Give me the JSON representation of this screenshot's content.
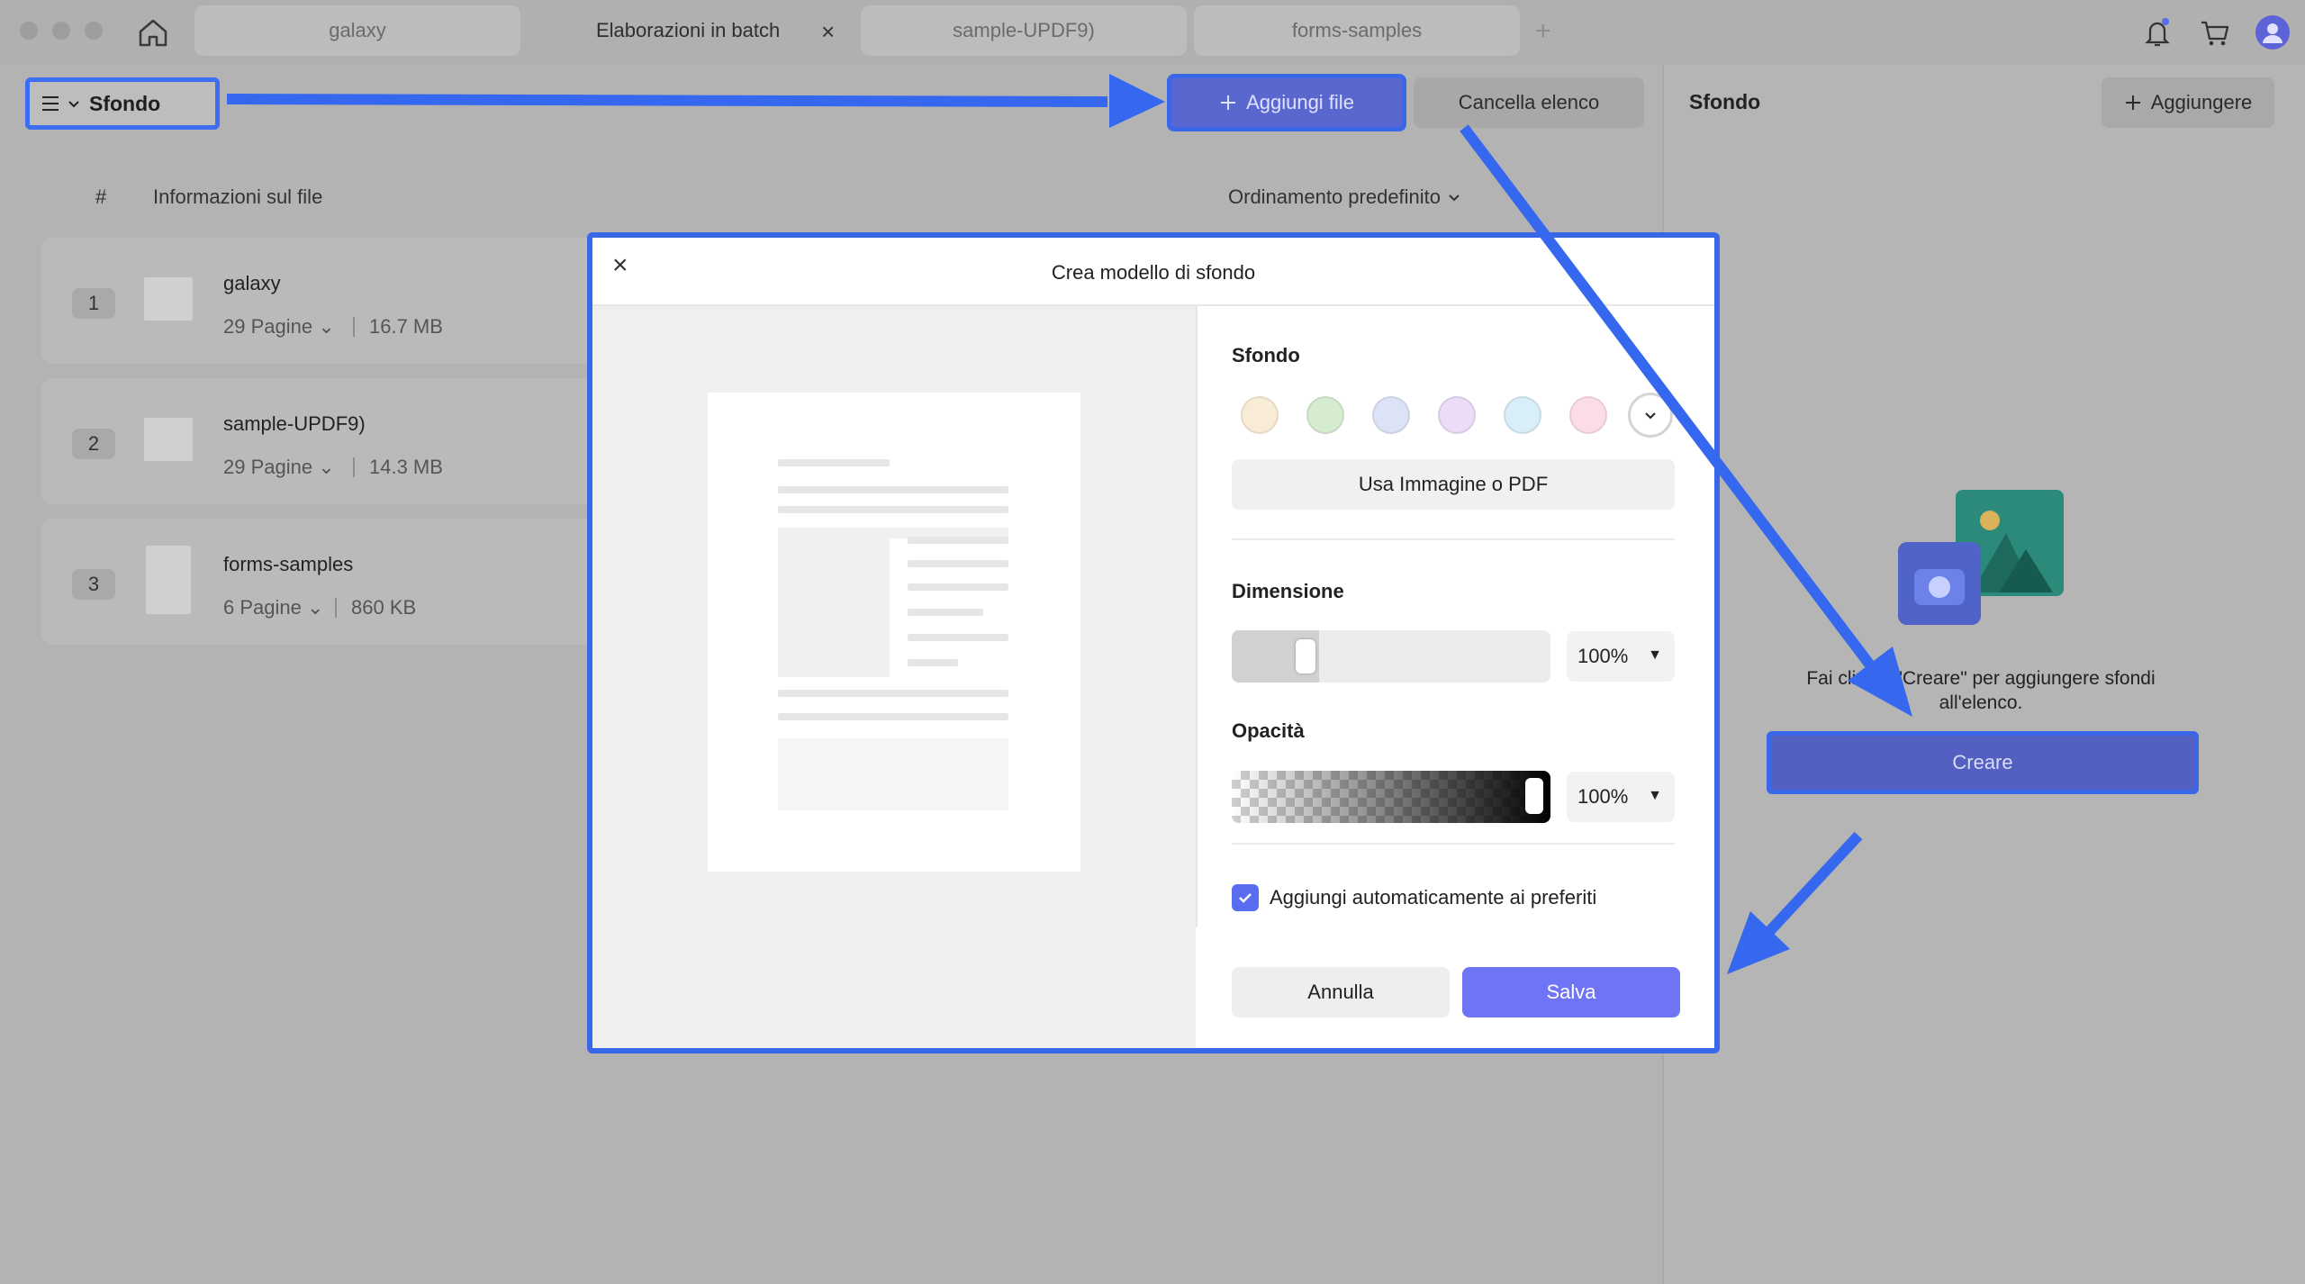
{
  "tabs": [
    {
      "label": "galaxy",
      "active": false
    },
    {
      "label": "Elaborazioni in batch",
      "active": true
    },
    {
      "label": "sample-UPDF9)",
      "active": false
    },
    {
      "label": "forms-samples",
      "active": false
    }
  ],
  "tab_close": "×",
  "tab_add": "+",
  "toolbar": {
    "menu_label": "Sfondo",
    "add_file_label": "Aggiungi file",
    "clear_label": "Cancella elenco"
  },
  "list": {
    "col_num": "#",
    "col_info": "Informazioni sul file",
    "sort_label": "Ordinamento predefinito",
    "files": [
      {
        "num": "1",
        "name": "galaxy",
        "pages": "29 Pagine",
        "size": "16.7 MB"
      },
      {
        "num": "2",
        "name": "sample-UPDF9)",
        "pages": "29 Pagine",
        "size": "14.3 MB"
      },
      {
        "num": "3",
        "name": "forms-samples",
        "pages": "6 Pagine",
        "size": "860 KB"
      }
    ]
  },
  "right_panel": {
    "title": "Sfondo",
    "add_label": "Aggiungere",
    "hint_line1": "Fai clic su \"Creare\" per aggiungere sfondi",
    "hint_line2": "all'elenco.",
    "create_label": "Creare"
  },
  "modal": {
    "close": "×",
    "title": "Crea modello di sfondo",
    "background_label": "Sfondo",
    "swatch_colors": [
      "#f8ecd6",
      "#d6ecd0",
      "#dde3f6",
      "#ecdcf8",
      "#d8eef8",
      "#fcdde6"
    ],
    "use_image_label": "Usa Immagine o PDF",
    "size_label": "Dimensione",
    "size_value": "100%",
    "size_slider_fraction": 0.25,
    "opacity_label": "Opacità",
    "opacity_value": "100%",
    "opacity_slider_fraction": 1.0,
    "fav_label": "Aggiungi automaticamente ai preferiti",
    "fav_checked": true,
    "cancel_label": "Annulla",
    "save_label": "Salva"
  },
  "colors": {
    "accent": "#3a66e8",
    "save_button": "#6f74f5",
    "checkbox": "#5a6cf0"
  },
  "icons": [
    "home-icon",
    "bell-icon",
    "cart-icon",
    "avatar-icon",
    "hamburger-icon",
    "chevron-down-icon",
    "plus-icon",
    "close-icon",
    "camera-icon",
    "image-icon",
    "check-icon"
  ]
}
